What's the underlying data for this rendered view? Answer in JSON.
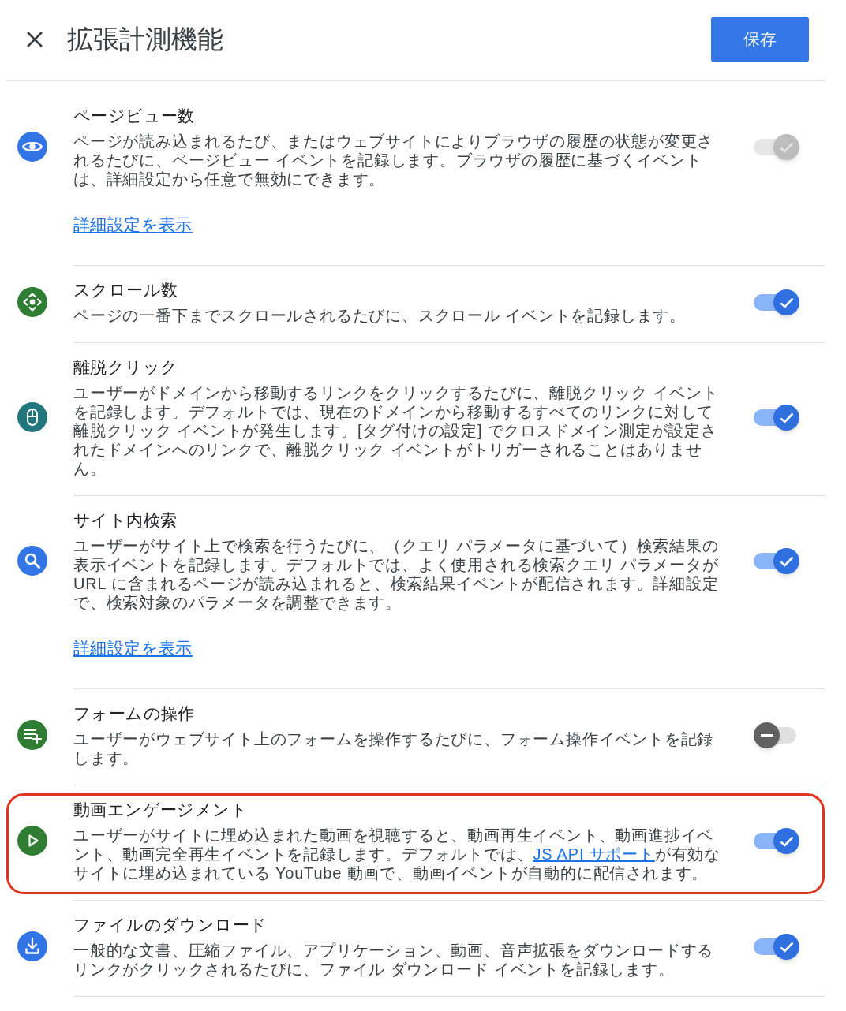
{
  "header": {
    "title": "拡張計測機能",
    "save_button": "保存"
  },
  "settings": [
    {
      "title": "ページビュー数",
      "description": [
        {
          "kind": "text",
          "text": "ページが読み込まれるたび、またはウェブサイトによりブラウザの履歴の状態が変更されるたびに、ページビュー イベントを記録します。ブラウザの履歴に基づくイベントは、詳細設定から任意で無効にできます。"
        }
      ],
      "link": "詳細設定を表示",
      "color": "#3174e3",
      "on": true,
      "disabled": true,
      "highlighted": false
    },
    {
      "title": "スクロール数",
      "description": [
        {
          "kind": "text",
          "text": "ページの一番下までスクロールされるたびに、スクロール イベントを記録します。"
        }
      ],
      "color": "#2e7d32",
      "on": true,
      "disabled": false,
      "highlighted": false
    },
    {
      "title": "離脱クリック",
      "description": [
        {
          "kind": "text",
          "text": "ユーザーがドメインから移動するリンクをクリックするたびに、離脱クリック イベントを記録します。デフォルトでは、現在のドメインから移動するすべてのリンクに対して離脱クリック イベントが発生します。[タグ付けの設定] でクロスドメイン測定が設定されたドメインへのリンクで、離脱クリック イベントがトリガーされることはありません。"
        }
      ],
      "color": "#21767e",
      "on": true,
      "disabled": false,
      "highlighted": false
    },
    {
      "title": "サイト内検索",
      "description": [
        {
          "kind": "text",
          "text": "ユーザーがサイト上で検索を行うたびに、（クエリ パラメータに基づいて）検索結果の表示イベントを記録します。デフォルトでは、よく使用される検索クエリ パラメータが URL に含まれるページが読み込まれると、検索結果イベントが配信されます。詳細設定で、検索対象のパラメータを調整できます。"
        }
      ],
      "link": "詳細設定を表示",
      "color": "#3174e3",
      "on": true,
      "disabled": false,
      "highlighted": false
    },
    {
      "title": "フォームの操作",
      "description": [
        {
          "kind": "text",
          "text": "ユーザーがウェブサイト上のフォームを操作するたびに、フォーム操作イベントを記録します。"
        }
      ],
      "color": "#2e7d32",
      "on": false,
      "disabled": false,
      "highlighted": false
    },
    {
      "title": "動画エンゲージメント",
      "description": [
        {
          "kind": "text",
          "text": "ユーザーがサイトに埋め込まれた動画を視聴すると、動画再生イベント、動画進捗イベント、動画完全再生イベントを記録します。デフォルトでは、"
        },
        {
          "kind": "link",
          "text": "JS API サポート"
        },
        {
          "kind": "text",
          "text": "が有効なサイトに埋め込まれている YouTube 動画で、動画イベントが自動的に配信されます。"
        }
      ],
      "color": "#2e7d32",
      "on": true,
      "disabled": false,
      "highlighted": true
    },
    {
      "title": "ファイルのダウンロード",
      "description": [
        {
          "kind": "text",
          "text": "一般的な文書、圧縮ファイル、アプリケーション、動画、音声拡張をダウンロードするリンクがクリックされるたびに、ファイル ダウンロード イベントを記録します。"
        }
      ],
      "color": "#3174e3",
      "on": true,
      "disabled": false,
      "highlighted": false
    }
  ]
}
